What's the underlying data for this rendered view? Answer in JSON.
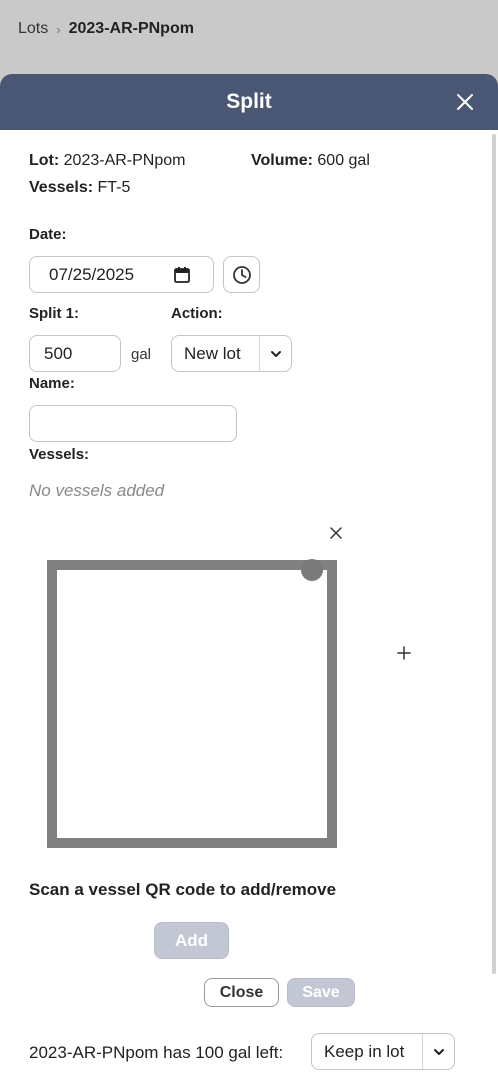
{
  "breadcrumb": {
    "parent": "Lots",
    "separator": "›",
    "current": "2023-AR-PNpom"
  },
  "modal": {
    "title": "Split",
    "lot_label": "Lot:",
    "lot_value": "2023-AR-PNpom",
    "volume_label": "Volume:",
    "volume_value": "600 gal",
    "vessels_label": "Vessels:",
    "vessels_value": "FT-5",
    "date_label": "Date:",
    "date_value": "07/25/2025",
    "split_label": "Split 1:",
    "split_value": "500",
    "split_unit": "gal",
    "action_label": "Action:",
    "action_value": "New lot",
    "name_label": "Name:",
    "name_value": "",
    "split_vessels_label": "Vessels:",
    "no_vessels_text": "No vessels added",
    "scan_text": "Scan a vessel QR code to add/remove",
    "add_label": "Add",
    "close_label": "Close",
    "save_label": "Save",
    "remaining_text": "2023-AR-PNpom has 100 gal left:",
    "remaining_action": "Keep in lot"
  },
  "icons": {
    "close": "close-icon",
    "calendar": "calendar-icon",
    "clock": "clock-icon",
    "chevron": "chevron-down-icon",
    "plus": "plus-icon",
    "remove": "remove-icon"
  },
  "colors": {
    "header": "#4a5774",
    "disabled_button": "#c3c7d4",
    "backdrop": "#c9c9c9"
  }
}
